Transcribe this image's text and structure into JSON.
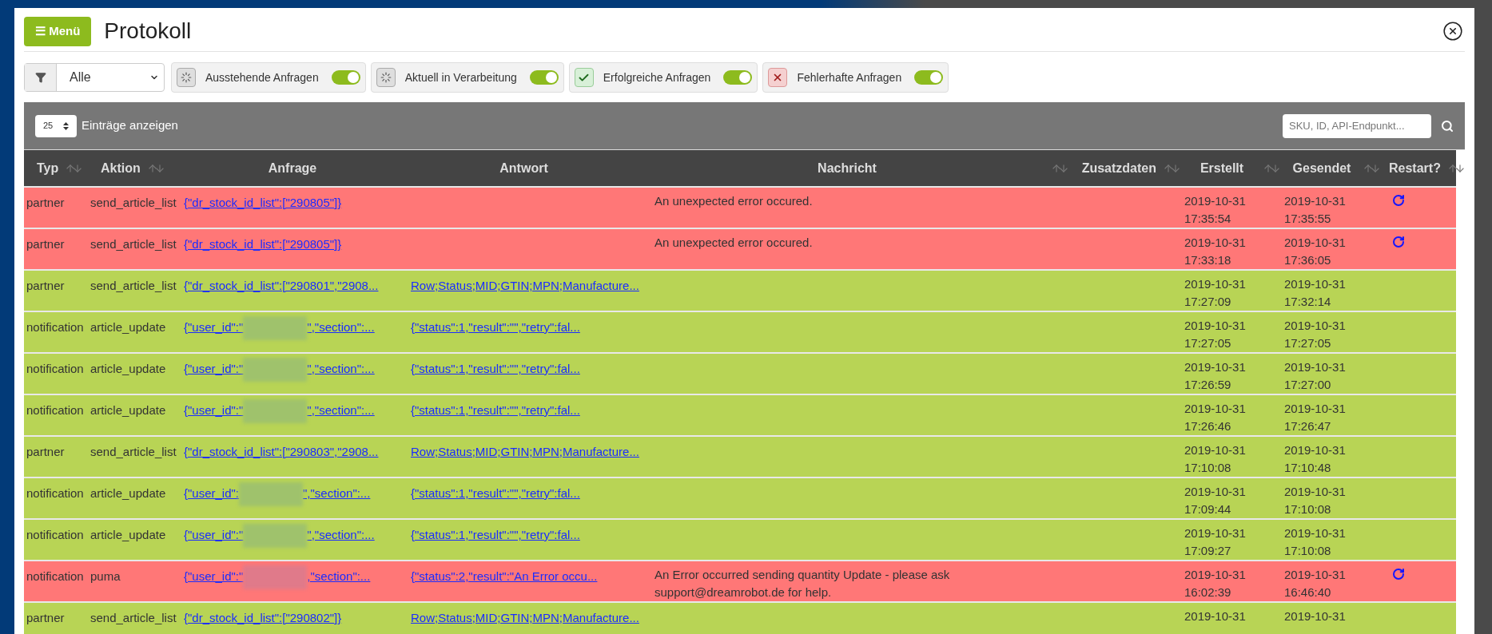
{
  "header": {
    "menu_button": "☰ Menü",
    "title": "Protokoll"
  },
  "filters": {
    "select": "Alle",
    "chips": [
      {
        "kind": "pending",
        "label": "Ausstehende Anfragen",
        "on": true
      },
      {
        "kind": "pending",
        "label": "Aktuell in Verarbeitung",
        "on": true
      },
      {
        "kind": "success",
        "label": "Erfolgreiche Anfragen",
        "on": true
      },
      {
        "kind": "error",
        "label": "Fehlerhafte Anfragen",
        "on": true
      }
    ]
  },
  "toolbar": {
    "page_size": "25",
    "page_size_label": "Einträge anzeigen",
    "search_placeholder": "SKU, ID, API-Endpunkt..."
  },
  "table": {
    "columns": [
      {
        "label": "Typ",
        "sortable": true
      },
      {
        "label": "Aktion",
        "sortable": true
      },
      {
        "label": "Anfrage",
        "sortable": false
      },
      {
        "label": "Antwort",
        "sortable": false
      },
      {
        "label": "Nachricht",
        "sortable": true
      },
      {
        "label": "Zusatzdaten",
        "sortable": true
      },
      {
        "label": "Erstellt",
        "sortable": true
      },
      {
        "label": "Gesendet",
        "sortable": true
      },
      {
        "label": "Restart?",
        "sortable": true
      }
    ],
    "rows": [
      {
        "kind": "error",
        "type": "partner",
        "action": "send_article_list",
        "request": "{\"dr_stock_id_list\":[\"290805\"]}",
        "message": "An unexpected error occured.",
        "created": [
          "2019-10-31",
          "17:35:54"
        ],
        "sent": [
          "2019-10-31",
          "17:35:55"
        ],
        "restart": true
      },
      {
        "kind": "error",
        "type": "partner",
        "action": "send_article_list",
        "request": "{\"dr_stock_id_list\":[\"290805\"]}",
        "message": "An unexpected error occured.",
        "created": [
          "2019-10-31",
          "17:33:18"
        ],
        "sent": [
          "2019-10-31",
          "17:36:05"
        ],
        "restart": true
      },
      {
        "kind": "success",
        "type": "partner",
        "action": "send_article_list",
        "request": "{\"dr_stock_id_list\":[\"290801\",\"2908...",
        "response": "Row;Status;MID;GTIN;MPN;Manufacture...",
        "created": [
          "2019-10-31",
          "17:27:09"
        ],
        "sent": [
          "2019-10-31",
          "17:32:14"
        ],
        "restart": false
      },
      {
        "kind": "success",
        "type": "notification",
        "action": "article_update",
        "request": "{\"user_id\":\"",
        "redacted": true,
        "request_tail": "\",\"section\":...",
        "response": "{\"status\":1,\"result\":\"\",\"retry\":fal...",
        "created": [
          "2019-10-31",
          "17:27:05"
        ],
        "sent": [
          "2019-10-31",
          "17:27:05"
        ],
        "restart": false
      },
      {
        "kind": "success",
        "type": "notification",
        "action": "article_update",
        "request": "{\"user_id\":\"",
        "redacted": true,
        "request_tail": "\",\"section\":...",
        "response": "{\"status\":1,\"result\":\"\",\"retry\":fal...",
        "created": [
          "2019-10-31",
          "17:26:59"
        ],
        "sent": [
          "2019-10-31",
          "17:27:00"
        ],
        "restart": false
      },
      {
        "kind": "success",
        "type": "notification",
        "action": "article_update",
        "request": "{\"user_id\":\"",
        "redacted": true,
        "request_tail": "\",\"section\":...",
        "response": "{\"status\":1,\"result\":\"\",\"retry\":fal...",
        "created": [
          "2019-10-31",
          "17:26:46"
        ],
        "sent": [
          "2019-10-31",
          "17:26:47"
        ],
        "restart": false
      },
      {
        "kind": "success",
        "type": "partner",
        "action": "send_article_list",
        "request": "{\"dr_stock_id_list\":[\"290803\",\"2908...",
        "response": "Row;Status;MID;GTIN;MPN;Manufacture...",
        "created": [
          "2019-10-31",
          "17:10:08"
        ],
        "sent": [
          "2019-10-31",
          "17:10:48"
        ],
        "restart": false
      },
      {
        "kind": "success",
        "type": "notification",
        "action": "article_update",
        "request": "{\"user_id\":",
        "redacted": true,
        "request_tail": "\",\"section\":...",
        "response": "{\"status\":1,\"result\":\"\",\"retry\":fal...",
        "created": [
          "2019-10-31",
          "17:09:44"
        ],
        "sent": [
          "2019-10-31",
          "17:10:08"
        ],
        "restart": false
      },
      {
        "kind": "success",
        "type": "notification",
        "action": "article_update",
        "request": "{\"user_id\":\"",
        "redacted": true,
        "request_tail": "\",\"section\":...",
        "response": "{\"status\":1,\"result\":\"\",\"retry\":fal...",
        "created": [
          "2019-10-31",
          "17:09:27"
        ],
        "sent": [
          "2019-10-31",
          "17:10:08"
        ],
        "restart": false
      },
      {
        "kind": "error",
        "type": "notification",
        "action": "puma",
        "request": "{\"user_id\":\"",
        "redacted": true,
        "request_tail": ",\"section\":...",
        "response": "{\"status\":2,\"result\":\"An Error occu...",
        "message": "An Error occurred sending quantity Update - please ask support@dreamrobot.de for help.",
        "created": [
          "2019-10-31",
          "16:02:39"
        ],
        "sent": [
          "2019-10-31",
          "16:46:40"
        ],
        "restart": true
      },
      {
        "kind": "success",
        "type": "partner",
        "action": "send_article_list",
        "request": "{\"dr_stock_id_list\":[\"290802\"]}",
        "response": "Row;Status;MID;GTIN;MPN;Manufacture...",
        "created": [
          "2019-10-31"
        ],
        "sent": [
          "2019-10-31"
        ],
        "restart": false
      }
    ]
  }
}
